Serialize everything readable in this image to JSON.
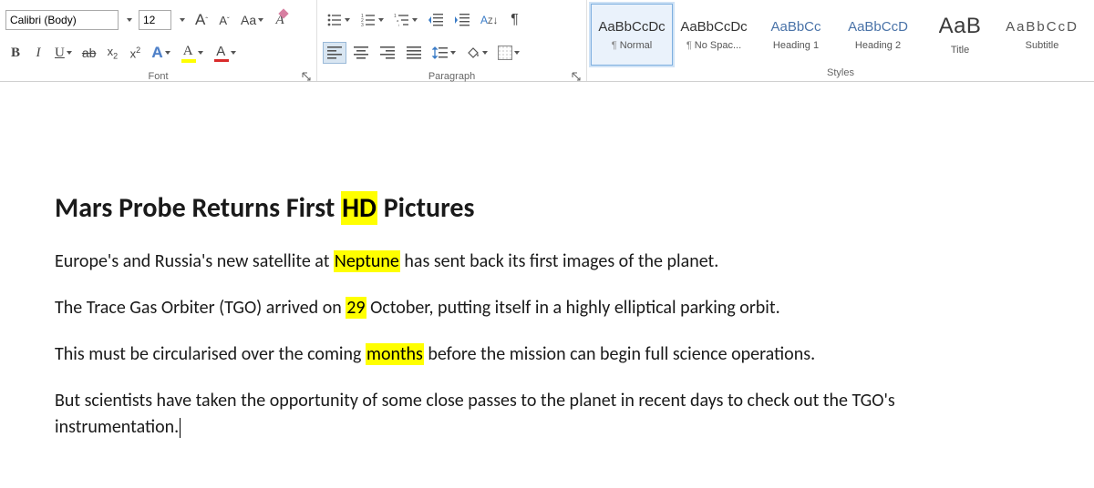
{
  "ribbon": {
    "font": {
      "name": "Calibri (Body)",
      "size": "12",
      "labels": {
        "grow": "A",
        "shrink": "A",
        "changecase": "Aa",
        "clear": "A",
        "bold": "B",
        "italic": "I",
        "underline": "U",
        "strike": "ab",
        "sub": "x",
        "sub2": "2",
        "sup": "x",
        "sup2": "2",
        "effects": "A",
        "highlight": "A",
        "color": "A"
      },
      "group_label": "Font"
    },
    "paragraph": {
      "group_label": "Paragraph",
      "sort": "A↓",
      "pilcrow": "¶"
    },
    "styles": {
      "group_label": "Styles",
      "items": [
        {
          "preview": "AaBbCcDc",
          "label": "Normal",
          "para": "¶",
          "cls": "",
          "selected": true
        },
        {
          "preview": "AaBbCcDc",
          "label": "No Spac...",
          "para": "¶",
          "cls": ""
        },
        {
          "preview": "AaBbCc",
          "label": "Heading 1",
          "para": "",
          "cls": "blue"
        },
        {
          "preview": "AaBbCcD",
          "label": "Heading 2",
          "para": "",
          "cls": "blue"
        },
        {
          "preview": "AaB",
          "label": "Title",
          "para": "",
          "cls": "title"
        },
        {
          "preview": "AaBbCcD",
          "label": "Subtitle",
          "para": "",
          "cls": "spaced"
        }
      ]
    }
  },
  "doc": {
    "heading": {
      "t1": "Mars Probe Returns First ",
      "hl": "HD",
      "t2": " Pictures"
    },
    "p1": {
      "t1": "Europe's and Russia's new satellite at ",
      "hl": "Neptune",
      "t2": " has sent back its first images of the planet."
    },
    "p2": {
      "t1": "The Trace Gas Orbiter (TGO) arrived on ",
      "hl": "29",
      "t2": " October, putting itself in a highly elliptical parking orbit."
    },
    "p3": {
      "t1": "This must be circularised over the coming ",
      "hl": "months",
      "t2": " before the mission can begin full science operations."
    },
    "p4": {
      "t1": "But scientists have taken the opportunity of some close passes to the planet in recent days to check out the TGO's instrumentation."
    }
  }
}
